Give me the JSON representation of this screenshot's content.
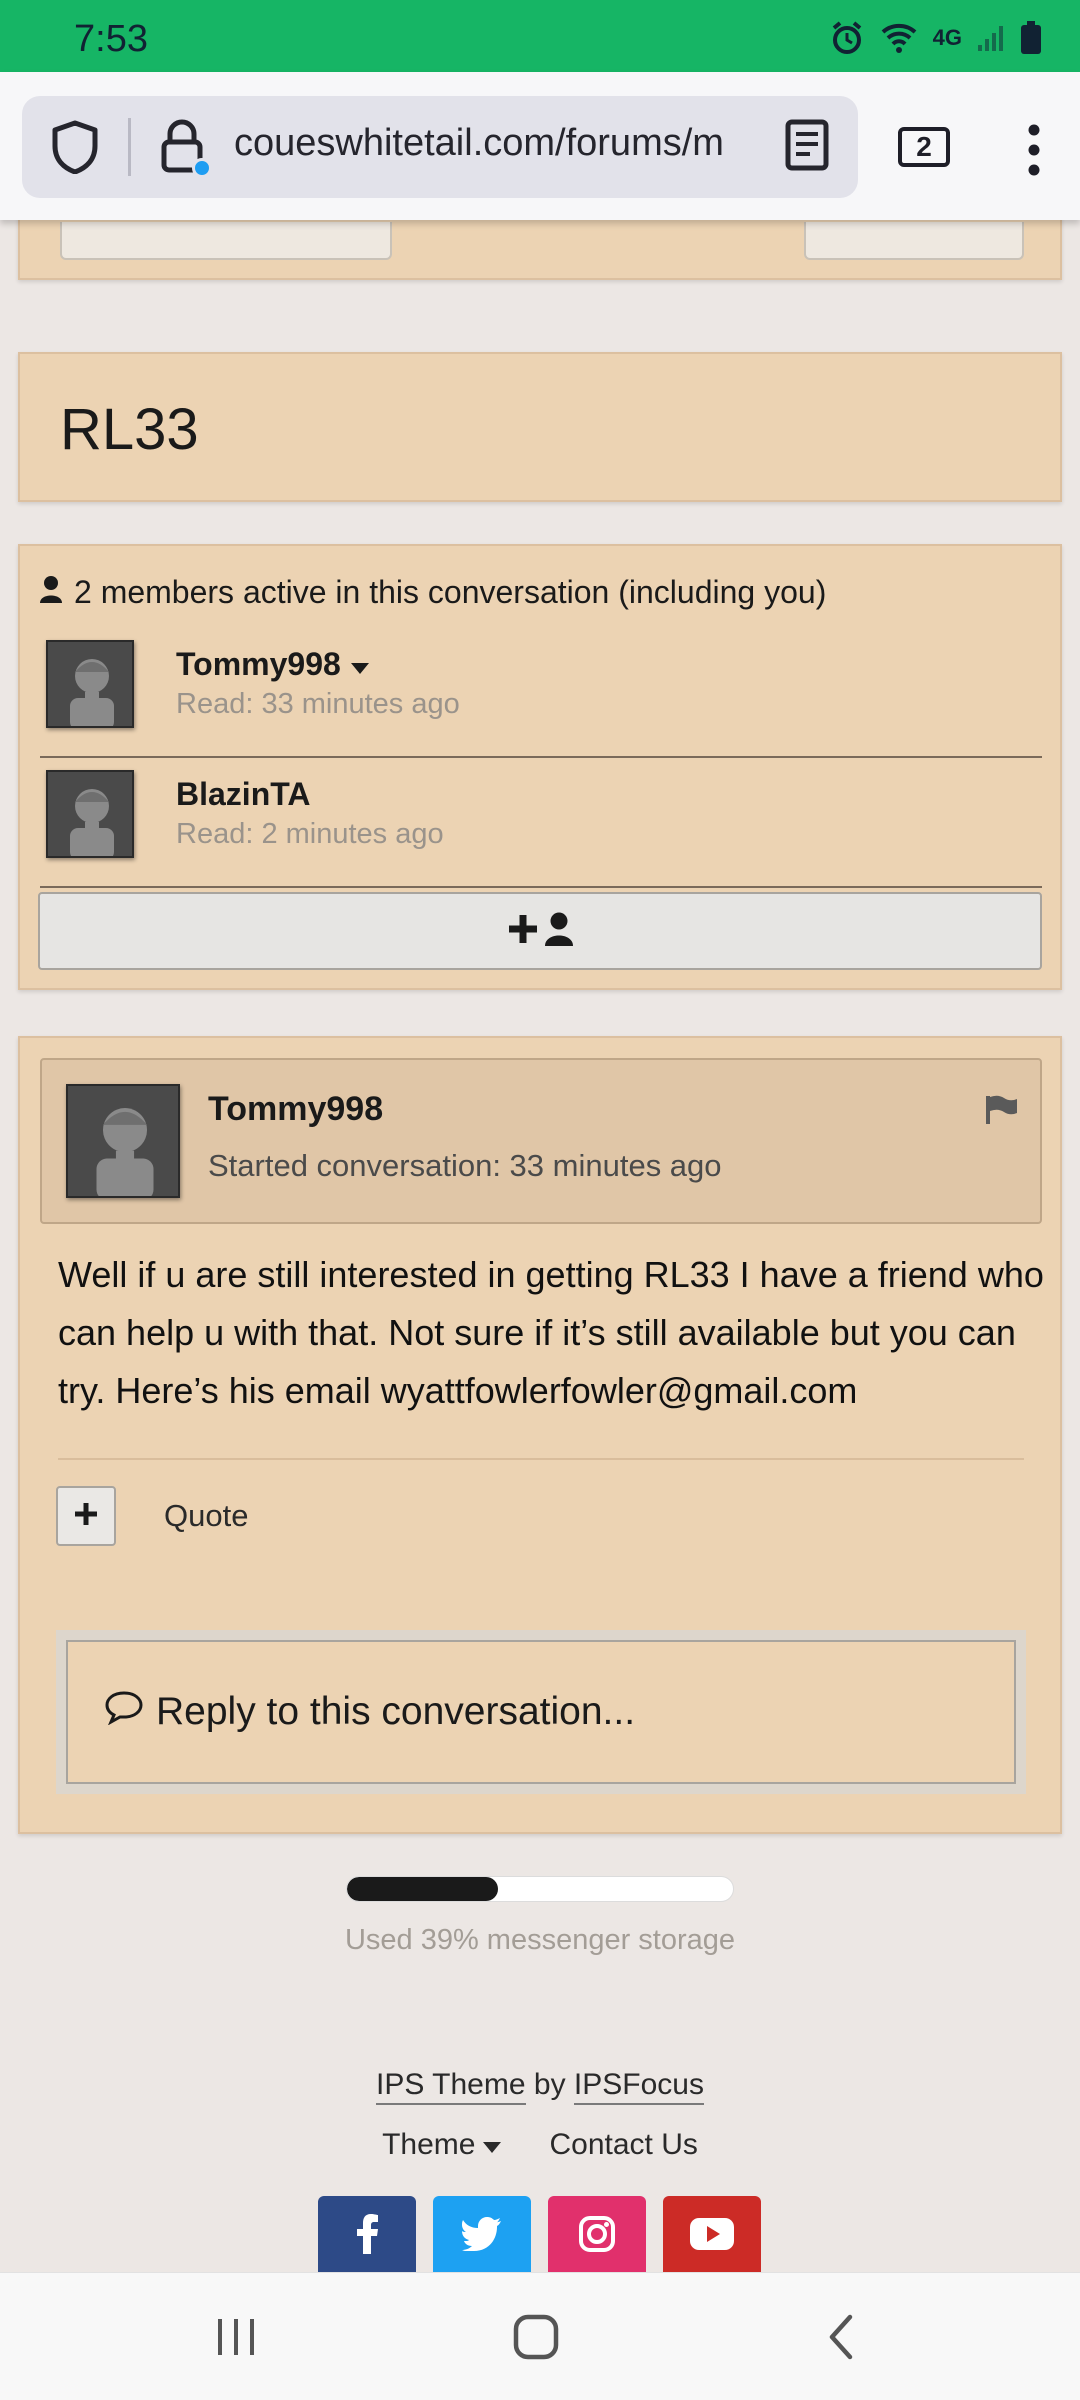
{
  "status_bar": {
    "time": "7:53",
    "network": "4G"
  },
  "browser": {
    "url": "coueswhitetail.com/forums/m",
    "tab_count": "2"
  },
  "conversation": {
    "title": "RL33"
  },
  "members": {
    "header": "2 members active in this conversation (including you)",
    "list": [
      {
        "name": "Tommy998",
        "read": "Read: 33 minutes ago"
      },
      {
        "name": "BlazinTA",
        "read": "Read: 2 minutes ago"
      }
    ]
  },
  "post": {
    "author": "Tommy998",
    "started": "Started conversation: 33 minutes ago",
    "body": "Well if u are still interested in getting RL33 I have a friend who can help u with that. Not sure if it’s still available but you can try. Here’s his email wyattfowlerfowler@gmail.com",
    "quote_label": "Quote",
    "reply_placeholder": "Reply to this conversation..."
  },
  "storage": {
    "label": "Used 39% messenger storage",
    "percent": 39
  },
  "footer": {
    "theme_credit": "IPS Theme",
    "by": "by",
    "author_credit": "IPSFocus",
    "theme_label": "Theme",
    "contact_label": "Contact Us"
  },
  "icons": {
    "social": [
      "facebook-icon",
      "twitter-icon",
      "instagram-icon",
      "youtube-icon"
    ]
  },
  "colors": {
    "status_bar": "#16b565",
    "panel": "#ecd3b3",
    "facebook": "#2d4a87",
    "twitter": "#1da1f2",
    "instagram": "#e1306c",
    "youtube": "#cc2b26"
  }
}
